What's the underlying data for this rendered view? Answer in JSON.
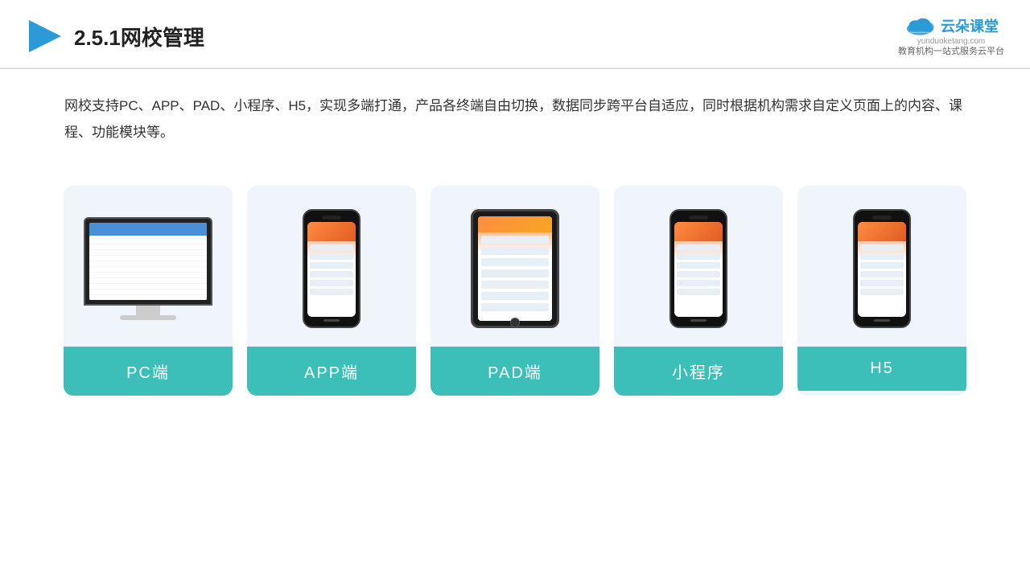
{
  "header": {
    "title": "2.5.1网校管理",
    "logo": {
      "name": "云朵课堂",
      "url": "yunduoketang.com",
      "tagline": "教育机构一站\n式服务云平台"
    }
  },
  "description": "网校支持PC、APP、PAD、小程序、H5，实现多端打通，产品各终端自由切换，数据同步跨平台自适应，同时根据机构需求自定义页面上的内容、课程、功能模块等。",
  "cards": [
    {
      "id": "pc",
      "label": "PC端",
      "device": "monitor"
    },
    {
      "id": "app",
      "label": "APP端",
      "device": "phone"
    },
    {
      "id": "pad",
      "label": "PAD端",
      "device": "tablet"
    },
    {
      "id": "miniprogram",
      "label": "小程序",
      "device": "phone"
    },
    {
      "id": "h5",
      "label": "H5",
      "device": "phone"
    }
  ]
}
